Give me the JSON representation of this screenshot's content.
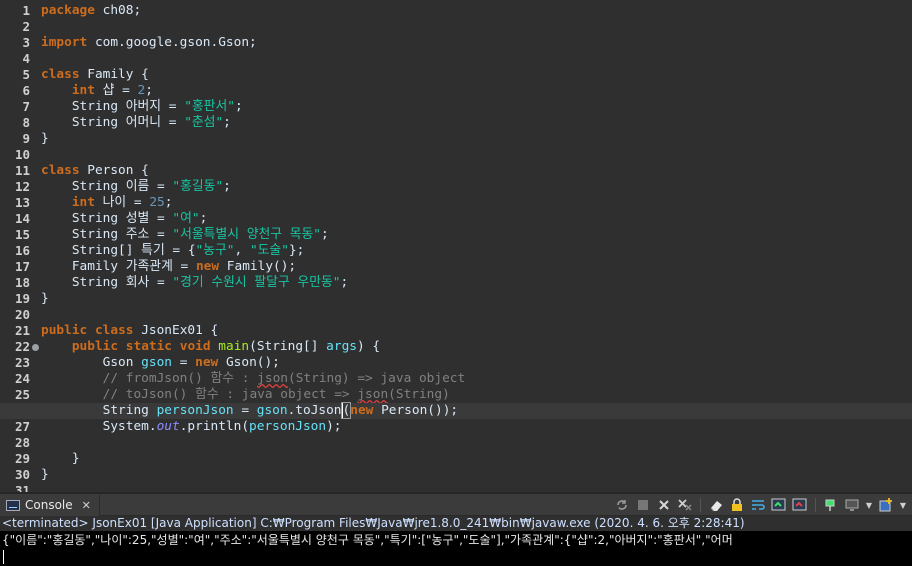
{
  "editor": {
    "line_numbers": [
      "1",
      "2",
      "3",
      "4",
      "5",
      "6",
      "7",
      "8",
      "9",
      "10",
      "11",
      "12",
      "13",
      "14",
      "15",
      "16",
      "17",
      "18",
      "19",
      "20",
      "21",
      "22",
      "23",
      "24",
      "25",
      "26",
      "27",
      "28",
      "29",
      "30",
      "31"
    ],
    "current_line": 26,
    "code": {
      "l1_kw": "package",
      "l1_rest": " ch08;",
      "l3_kw": "import",
      "l3_rest": " com.google.gson.Gson;",
      "l5_kw": "class",
      "l5_rest": " Family {",
      "l6_kw": "int",
      "l6_a": " 샵 = ",
      "l6_num": "2",
      "l6_b": ";",
      "l7_a": "String 아버지 = ",
      "l7_str": "\"홍판서\"",
      "l7_b": ";",
      "l8_a": "String 어머니 = ",
      "l8_str": "\"춘섬\"",
      "l8_b": ";",
      "l9": "}",
      "l11_kw": "class",
      "l11_rest": " Person {",
      "l12_a": "String 이름 = ",
      "l12_str": "\"홍길동\"",
      "l12_b": ";",
      "l13_kw": "int",
      "l13_a": " 나이 = ",
      "l13_num": "25",
      "l13_b": ";",
      "l14_a": "String 성별 = ",
      "l14_str": "\"여\"",
      "l14_b": ";",
      "l15_a": "String 주소 = ",
      "l15_str": "\"서울특별시 양천구 목동\"",
      "l15_b": ";",
      "l16_a": "String[] 특기 = {",
      "l16_str1": "\"농구\"",
      "l16_b": ", ",
      "l16_str2": "\"도술\"",
      "l16_c": "};",
      "l17_a": "Family 가족관계 = ",
      "l17_kw": "new",
      "l17_b": " Family();",
      "l18_a": "String 회사 = ",
      "l18_str": "\"경기 수원시 팔달구 우만동\"",
      "l18_b": ";",
      "l19": "}",
      "l21_kw1": "public",
      "l21_kw2": "class",
      "l21_rest": " JsonEx01 {",
      "l22_kw1": "public",
      "l22_kw2": "static",
      "l22_kw3": "void",
      "l22_meth": "main",
      "l22_a": "(String[] ",
      "l22_var": "args",
      "l22_b": ") {",
      "l23_a": "Gson ",
      "l23_var": "gson",
      "l23_b": " = ",
      "l23_kw": "new",
      "l23_c": " Gson();",
      "l24_a": "// fromJson() 함수 : ",
      "l24_sq": "json",
      "l24_b": "(String) => java object",
      "l25_a": "// toJson() 함수 : java object => ",
      "l25_sq": "json",
      "l25_b": "(String)",
      "l26_a": "String ",
      "l26_var1": "personJson",
      "l26_b": " = ",
      "l26_var2": "gson",
      "l26_c": ".toJson",
      "l26_paren": "(",
      "l26_kw": "new",
      "l26_d": " Person());",
      "l27_a": "System.",
      "l27_sfld": "out",
      "l27_b": ".println(",
      "l27_var": "personJson",
      "l27_c": ");",
      "l29": "}",
      "l30": "}"
    }
  },
  "console": {
    "tab_label": "Console",
    "close_glyph": "✕",
    "status": "<terminated> JsonEx01 [Java Application] C:₩Program Files₩Java₩jre1.8.0_241₩bin₩javaw.exe (2020. 4. 6. 오후 2:28:41)",
    "output": "{\"이름\":\"홍길동\",\"나이\":25,\"성별\":\"여\",\"주소\":\"서울특별시 양천구 목동\",\"특기\":[\"농구\",\"도술\"],\"가족관계\":{\"샵\":2,\"아버지\":\"홍판서\",\"어머",
    "toolbar_icons": [
      "sync-icon",
      "stop-icon",
      "remove-launch-icon",
      "remove-all-terminated-icon",
      "clear-console-icon",
      "scroll-lock-icon",
      "word-wrap-icon",
      "show-on-stdout-icon",
      "show-on-stderr-icon",
      "pin-console-icon",
      "display-selected-console-icon",
      "open-console-icon"
    ]
  },
  "colors": {
    "editor_bg": "#2f2f2f",
    "keyword": "#cc6c1d",
    "string": "#17c6a3",
    "comment": "#808080",
    "number": "#6897bb",
    "variable": "#66e1f8",
    "method": "#a7ec21",
    "console_bg": "#000000"
  }
}
